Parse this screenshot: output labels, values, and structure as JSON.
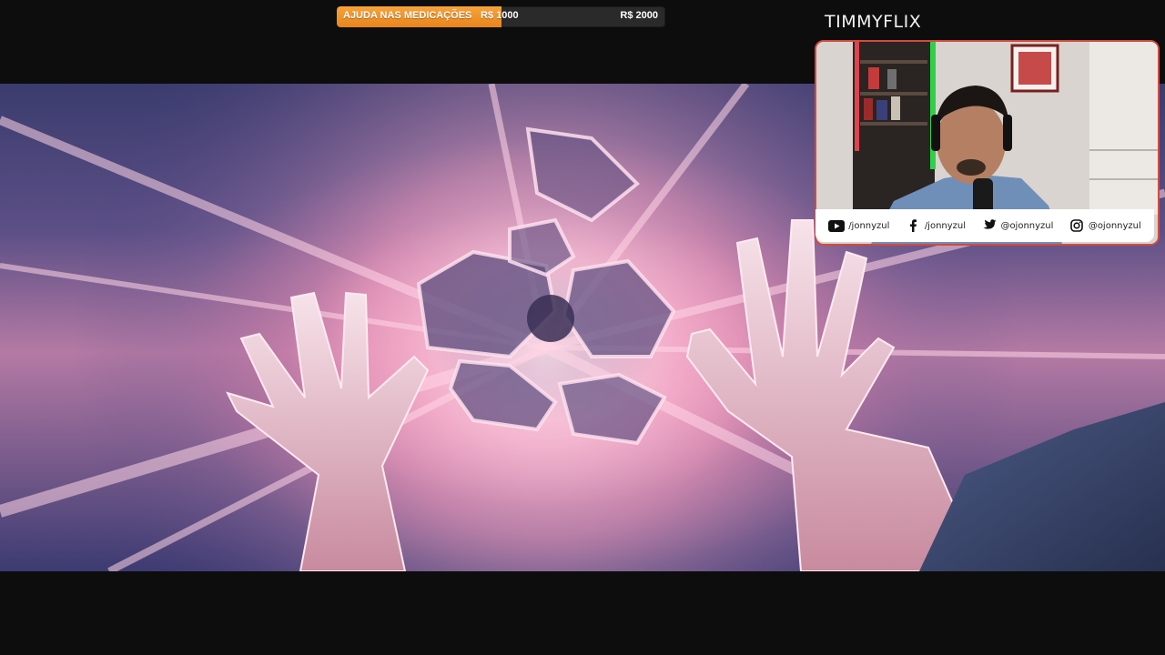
{
  "stream": {
    "channel_title": "TIMMYFLIX"
  },
  "donation_goal": {
    "label": "AJUDA NAS MEDICAÇÕES",
    "current": "R$ 1000",
    "target": "R$ 2000",
    "progress": 0.5,
    "fill_color": "#ee8a20"
  },
  "webcam": {
    "border_color": "#d34a3d"
  },
  "socials": [
    {
      "icon": "youtube-icon",
      "handle": "/jonnyzul"
    },
    {
      "icon": "facebook-icon",
      "handle": "/jonnyzul"
    },
    {
      "icon": "twitter-icon",
      "handle": "@ojonnyzul"
    },
    {
      "icon": "instagram-icon",
      "handle": "@ojonnyzul"
    }
  ]
}
